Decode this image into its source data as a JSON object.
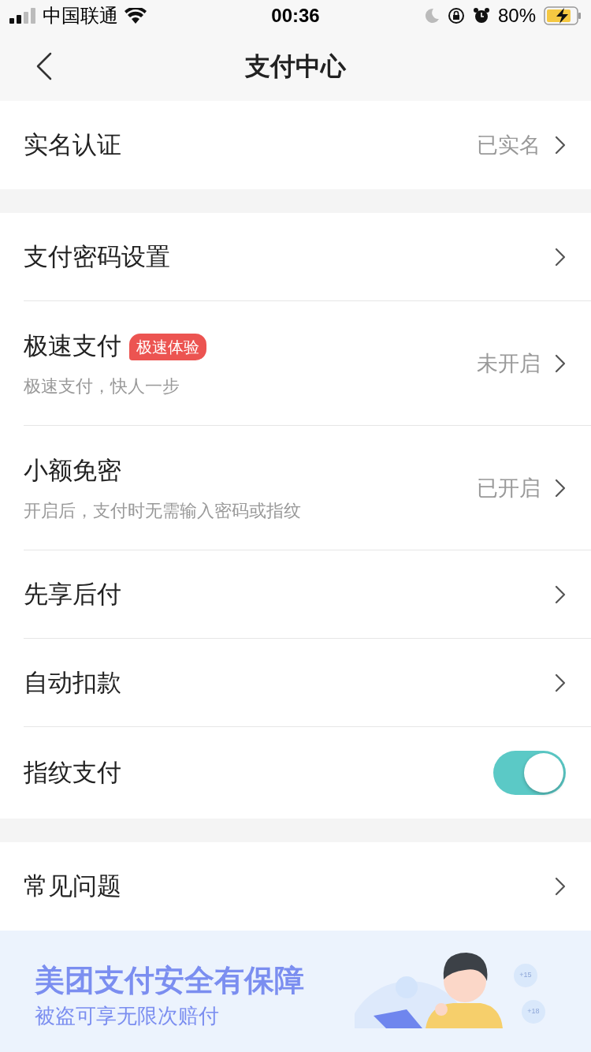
{
  "status_bar": {
    "carrier": "中国联通",
    "time": "00:36",
    "battery": "80%"
  },
  "nav": {
    "title": "支付中心"
  },
  "sections": [
    {
      "items": [
        {
          "kind": "link",
          "label": "实名认证",
          "value": "已实名"
        }
      ]
    },
    {
      "items": [
        {
          "kind": "link",
          "label": "支付密码设置"
        },
        {
          "kind": "link",
          "label": "极速支付",
          "badge": "极速体验",
          "subtitle": "极速支付，快人一步",
          "value": "未开启"
        },
        {
          "kind": "link",
          "label": "小额免密",
          "subtitle": "开启后，支付时无需输入密码或指纹",
          "value": "已开启"
        },
        {
          "kind": "link",
          "label": "先享后付"
        },
        {
          "kind": "link",
          "label": "自动扣款"
        },
        {
          "kind": "toggle",
          "label": "指纹支付",
          "on": true
        }
      ]
    },
    {
      "items": [
        {
          "kind": "link",
          "label": "常见问题"
        }
      ]
    }
  ],
  "banner": {
    "title": "美团支付安全有保障",
    "subtitle": "被盗可享无限次赔付",
    "bubbles": [
      "+15",
      "+18"
    ]
  }
}
